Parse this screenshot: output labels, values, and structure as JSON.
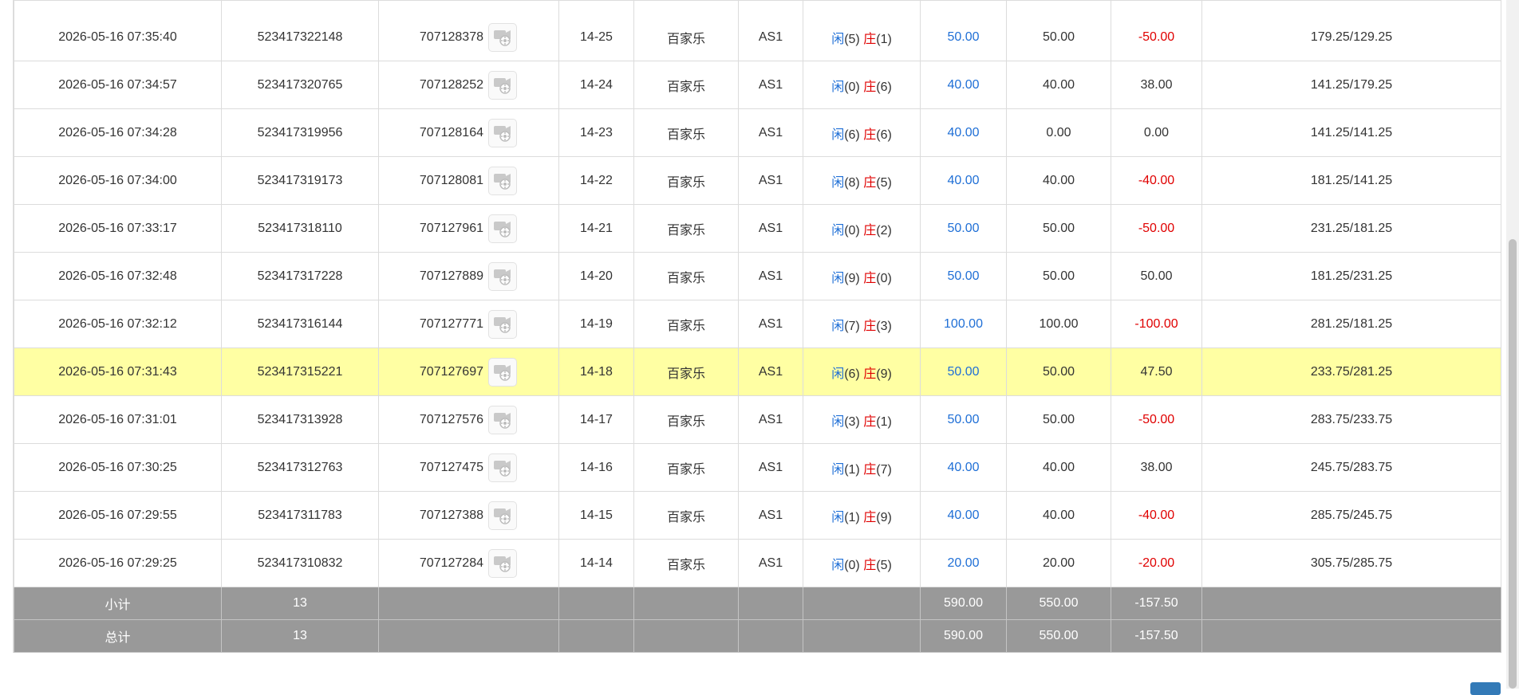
{
  "rows": [
    {
      "time": "2026-05-16 07:35:40",
      "bet_id": "523417322148",
      "round": "707128378",
      "table": "14-25",
      "game": "百家乐",
      "room": "AS1",
      "p_label": "闲",
      "p_val": "(5)",
      "b_label": "庄",
      "b_val": "(1)",
      "bet": "50.00",
      "valid": "50.00",
      "win": "-50.00",
      "win_neg": true,
      "balance": "179.25/129.25"
    },
    {
      "time": "2026-05-16 07:34:57",
      "bet_id": "523417320765",
      "round": "707128252",
      "table": "14-24",
      "game": "百家乐",
      "room": "AS1",
      "p_label": "闲",
      "p_val": "(0)",
      "b_label": "庄",
      "b_val": "(6)",
      "bet": "40.00",
      "valid": "40.00",
      "win": "38.00",
      "win_neg": false,
      "balance": "141.25/179.25"
    },
    {
      "time": "2026-05-16 07:34:28",
      "bet_id": "523417319956",
      "round": "707128164",
      "table": "14-23",
      "game": "百家乐",
      "room": "AS1",
      "p_label": "闲",
      "p_val": "(6)",
      "b_label": "庄",
      "b_val": "(6)",
      "bet": "40.00",
      "valid": "0.00",
      "win": "0.00",
      "win_neg": false,
      "balance": "141.25/141.25"
    },
    {
      "time": "2026-05-16 07:34:00",
      "bet_id": "523417319173",
      "round": "707128081",
      "table": "14-22",
      "game": "百家乐",
      "room": "AS1",
      "p_label": "闲",
      "p_val": "(8)",
      "b_label": "庄",
      "b_val": "(5)",
      "bet": "40.00",
      "valid": "40.00",
      "win": "-40.00",
      "win_neg": true,
      "balance": "181.25/141.25"
    },
    {
      "time": "2026-05-16 07:33:17",
      "bet_id": "523417318110",
      "round": "707127961",
      "table": "14-21",
      "game": "百家乐",
      "room": "AS1",
      "p_label": "闲",
      "p_val": "(0)",
      "b_label": "庄",
      "b_val": "(2)",
      "bet": "50.00",
      "valid": "50.00",
      "win": "-50.00",
      "win_neg": true,
      "balance": "231.25/181.25"
    },
    {
      "time": "2026-05-16 07:32:48",
      "bet_id": "523417317228",
      "round": "707127889",
      "table": "14-20",
      "game": "百家乐",
      "room": "AS1",
      "p_label": "闲",
      "p_val": "(9)",
      "b_label": "庄",
      "b_val": "(0)",
      "bet": "50.00",
      "valid": "50.00",
      "win": "50.00",
      "win_neg": false,
      "balance": "181.25/231.25"
    },
    {
      "time": "2026-05-16 07:32:12",
      "bet_id": "523417316144",
      "round": "707127771",
      "table": "14-19",
      "game": "百家乐",
      "room": "AS1",
      "p_label": "闲",
      "p_val": "(7)",
      "b_label": "庄",
      "b_val": "(3)",
      "bet": "100.00",
      "valid": "100.00",
      "win": "-100.00",
      "win_neg": true,
      "balance": "281.25/181.25"
    },
    {
      "time": "2026-05-16 07:31:43",
      "bet_id": "523417315221",
      "round": "707127697",
      "table": "14-18",
      "game": "百家乐",
      "room": "AS1",
      "p_label": "闲",
      "p_val": "(6)",
      "b_label": "庄",
      "b_val": "(9)",
      "bet": "50.00",
      "valid": "50.00",
      "win": "47.50",
      "win_neg": false,
      "balance": "233.75/281.25",
      "highlighted": true
    },
    {
      "time": "2026-05-16 07:31:01",
      "bet_id": "523417313928",
      "round": "707127576",
      "table": "14-17",
      "game": "百家乐",
      "room": "AS1",
      "p_label": "闲",
      "p_val": "(3)",
      "b_label": "庄",
      "b_val": "(1)",
      "bet": "50.00",
      "valid": "50.00",
      "win": "-50.00",
      "win_neg": true,
      "balance": "283.75/233.75"
    },
    {
      "time": "2026-05-16 07:30:25",
      "bet_id": "523417312763",
      "round": "707127475",
      "table": "14-16",
      "game": "百家乐",
      "room": "AS1",
      "p_label": "闲",
      "p_val": "(1)",
      "b_label": "庄",
      "b_val": "(7)",
      "bet": "40.00",
      "valid": "40.00",
      "win": "38.00",
      "win_neg": false,
      "balance": "245.75/283.75"
    },
    {
      "time": "2026-05-16 07:29:55",
      "bet_id": "523417311783",
      "round": "707127388",
      "table": "14-15",
      "game": "百家乐",
      "room": "AS1",
      "p_label": "闲",
      "p_val": "(1)",
      "b_label": "庄",
      "b_val": "(9)",
      "bet": "40.00",
      "valid": "40.00",
      "win": "-40.00",
      "win_neg": true,
      "balance": "285.75/245.75"
    },
    {
      "time": "2026-05-16 07:29:25",
      "bet_id": "523417310832",
      "round": "707127284",
      "table": "14-14",
      "game": "百家乐",
      "room": "AS1",
      "p_label": "闲",
      "p_val": "(0)",
      "b_label": "庄",
      "b_val": "(5)",
      "bet": "20.00",
      "valid": "20.00",
      "win": "-20.00",
      "win_neg": true,
      "balance": "305.75/285.75"
    }
  ],
  "subtotal": {
    "label": "小计",
    "count": "13",
    "bet": "590.00",
    "valid": "550.00",
    "win": "-157.50"
  },
  "total": {
    "label": "总计",
    "count": "13",
    "bet": "590.00",
    "valid": "550.00",
    "win": "-157.50"
  },
  "icons": {
    "round_video": "video-replay-icon"
  },
  "colors": {
    "player": "#1f6fd6",
    "banker": "#e00000",
    "highlight": "#ffffa3",
    "total_bg": "#999999"
  }
}
